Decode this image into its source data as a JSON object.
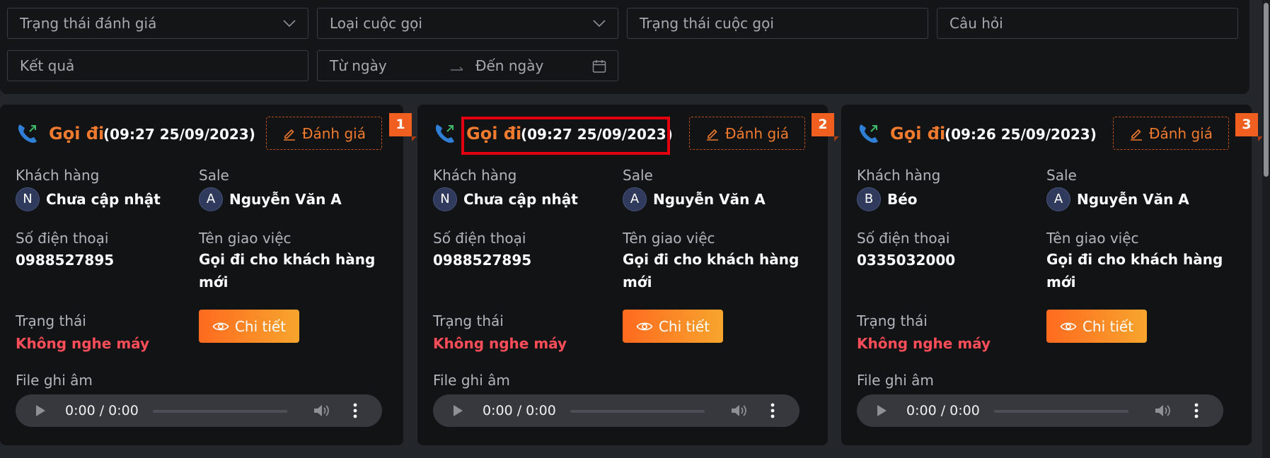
{
  "filters": {
    "evaluation_status": "Trạng thái đánh giá",
    "call_type": "Loại cuộc gọi",
    "call_status": "Trạng thái cuộc gọi",
    "question": "Câu hỏi",
    "result": "Kết quả",
    "from_date": "Từ ngày",
    "to_date": "Đến ngày"
  },
  "labels": {
    "customer": "Khách hàng",
    "sale": "Sale",
    "phone": "Số điện thoại",
    "task": "Tên giao việc",
    "status": "Trạng thái",
    "recording": "File ghi âm",
    "rate": "Đánh giá",
    "detail": "Chi tiết"
  },
  "cards": [
    {
      "index": "1",
      "type": "Gọi đi",
      "time": "(09:27 25/09/2023)",
      "customer_initial": "N",
      "customer": "Chưa cập nhật",
      "sale_initial": "A",
      "sale": "Nguyễn Văn A",
      "phone": "0988527895",
      "task": "Gọi đi cho khách hàng mới",
      "status": "Không nghe máy",
      "audio_time": "0:00 / 0:00"
    },
    {
      "index": "2",
      "type": "Gọi đi",
      "time": "(09:27 25/09/2023)",
      "customer_initial": "N",
      "customer": "Chưa cập nhật",
      "sale_initial": "A",
      "sale": "Nguyễn Văn A",
      "phone": "0988527895",
      "task": "Gọi đi cho khách hàng mới",
      "status": "Không nghe máy",
      "audio_time": "0:00 / 0:00"
    },
    {
      "index": "3",
      "type": "Gọi đi",
      "time": "(09:26 25/09/2023)",
      "customer_initial": "B",
      "customer": "Béo",
      "sale_initial": "A",
      "sale": "Nguyễn Văn A",
      "phone": "0335032000",
      "task": "Gọi đi cho khách hàng mới",
      "status": "Không nghe máy",
      "audio_time": "0:00 / 0:00"
    }
  ],
  "colors": {
    "accent": "#f07a2e",
    "status_red": "#ff4d5a",
    "highlight": "#e3000f"
  }
}
